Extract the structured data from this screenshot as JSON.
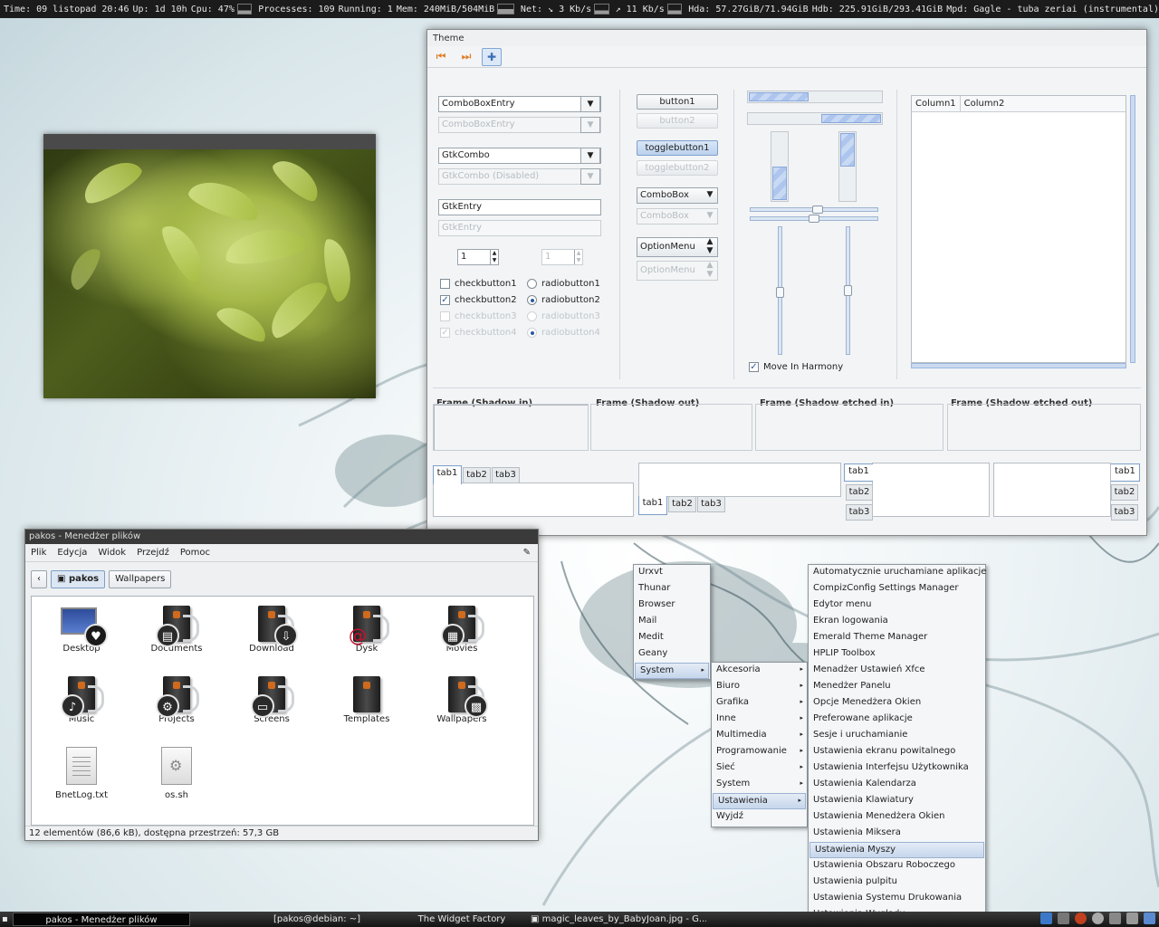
{
  "topbar": {
    "time": "Time: 09 listopad 20:46",
    "up": "Up: 1d 10h",
    "cpu": "Cpu: 47%",
    "processes": "Processes: 109",
    "running": "Running: 1",
    "mem": "Mem: 240MiB/504MiB",
    "net_down": "Net: ↘ 3 Kb/s",
    "net_up": "↗ 11 Kb/s",
    "hda": "Hda: 57.27GiB/71.94GiB",
    "hdb": "Hdb: 225.91GiB/293.41GiB",
    "mpd": "Mpd: Gagle - tuba zeriai (instrumental)"
  },
  "theme": {
    "title": "Theme",
    "combo_entry": "ComboBoxEntry",
    "combo_entry_dis": "ComboBoxEntry",
    "gtkcombo": "GtkCombo",
    "gtkcombo_dis": "GtkCombo (Disabled)",
    "gtkentry": "GtkEntry",
    "gtkentry_dis": "GtkEntry",
    "spin1": "1",
    "spin2": "1",
    "check1": "checkbutton1",
    "check2": "checkbutton2",
    "check3": "checkbutton3",
    "check4": "checkbutton4",
    "radio1": "radiobutton1",
    "radio2": "radiobutton2",
    "radio3": "radiobutton3",
    "radio4": "radiobutton4",
    "button1": "button1",
    "button2": "button2",
    "toggle1": "togglebutton1",
    "toggle2": "togglebutton2",
    "combobox": "ComboBox",
    "combobox_dis": "ComboBox",
    "option": "OptionMenu",
    "option_dis": "OptionMenu",
    "harmony": "Move In Harmony",
    "col1": "Column1",
    "col2": "Column2",
    "frame_in": "Frame (Shadow in)",
    "frame_out": "Frame (Shadow out)",
    "frame_etched_in": "Frame (Shadow etched in)",
    "frame_etched_out": "Frame (Shadow etched out)",
    "tab1": "tab1",
    "tab2": "tab2",
    "tab3": "tab3",
    "progress_h1": 0.45,
    "progress_h2": 0.45,
    "progress_v1": 0.5,
    "progress_v2": 0.5
  },
  "fm": {
    "title": "pakos - Menedżer plików",
    "menu": [
      "Plik",
      "Edycja",
      "Widok",
      "Przejdź",
      "Pomoc"
    ],
    "path": [
      "pakos",
      "Wallpapers"
    ],
    "items": [
      {
        "label": "Desktop",
        "emblem": "heart-icon"
      },
      {
        "label": "Documents",
        "emblem": "document-icon"
      },
      {
        "label": "Download",
        "emblem": "download-icon"
      },
      {
        "label": "Dysk",
        "emblem": "debian-icon"
      },
      {
        "label": "Movies",
        "emblem": "film-icon"
      },
      {
        "label": "Music",
        "emblem": "music-icon"
      },
      {
        "label": "Projects",
        "emblem": "gear-icon"
      },
      {
        "label": "Screens",
        "emblem": "screen-icon"
      },
      {
        "label": "Templates",
        "emblem": ""
      },
      {
        "label": "Wallpapers",
        "emblem": "picture-icon"
      },
      {
        "label": "BnetLog.txt",
        "emblem": "text-file-icon"
      },
      {
        "label": "os.sh",
        "emblem": "script-file-icon"
      }
    ],
    "status": "12 elementów (86,6 kB), dostępna przestrzeń: 57,3 GB"
  },
  "menu1": [
    "Urxvt",
    "Thunar",
    "Browser",
    "Mail",
    "Medit",
    "Geany",
    "System"
  ],
  "menu2": [
    "Akcesoria",
    "Biuro",
    "Grafika",
    "Inne",
    "Multimedia",
    "Programowanie",
    "Sieć",
    "System",
    "Ustawienia",
    "Wyjdź"
  ],
  "menu3": [
    "Automatycznie uruchamiane aplikacje",
    "CompizConfig Settings Manager",
    "Edytor menu",
    "Ekran logowania",
    "Emerald Theme Manager",
    "HPLIP Toolbox",
    "Menadżer Ustawień Xfce",
    "Menedżer Panelu",
    "Opcje Menedżera Okien",
    "Preferowane aplikacje",
    "Sesje i uruchamianie",
    "Ustawienia ekranu powitalnego",
    "Ustawienia Interfejsu Użytkownika",
    "Ustawienia Kalendarza",
    "Ustawienia Klawiatury",
    "Ustawienia Menedżera Okien",
    "Ustawienia Miksera",
    "Ustawienia Myszy",
    "Ustawienia Obszaru Roboczego",
    "Ustawienia pulpitu",
    "Ustawienia Systemu Drukowania",
    "Ustawienia Wyglądu"
  ],
  "taskbar": [
    "pakos - Menedżer plików",
    "[pakos@debian: ~]",
    "The Widget Factory",
    "magic_leaves_by_BabyJoan.jpg - G..."
  ],
  "colors": {
    "accent": "#3b6fb6",
    "selection": "#c6d6ec"
  }
}
